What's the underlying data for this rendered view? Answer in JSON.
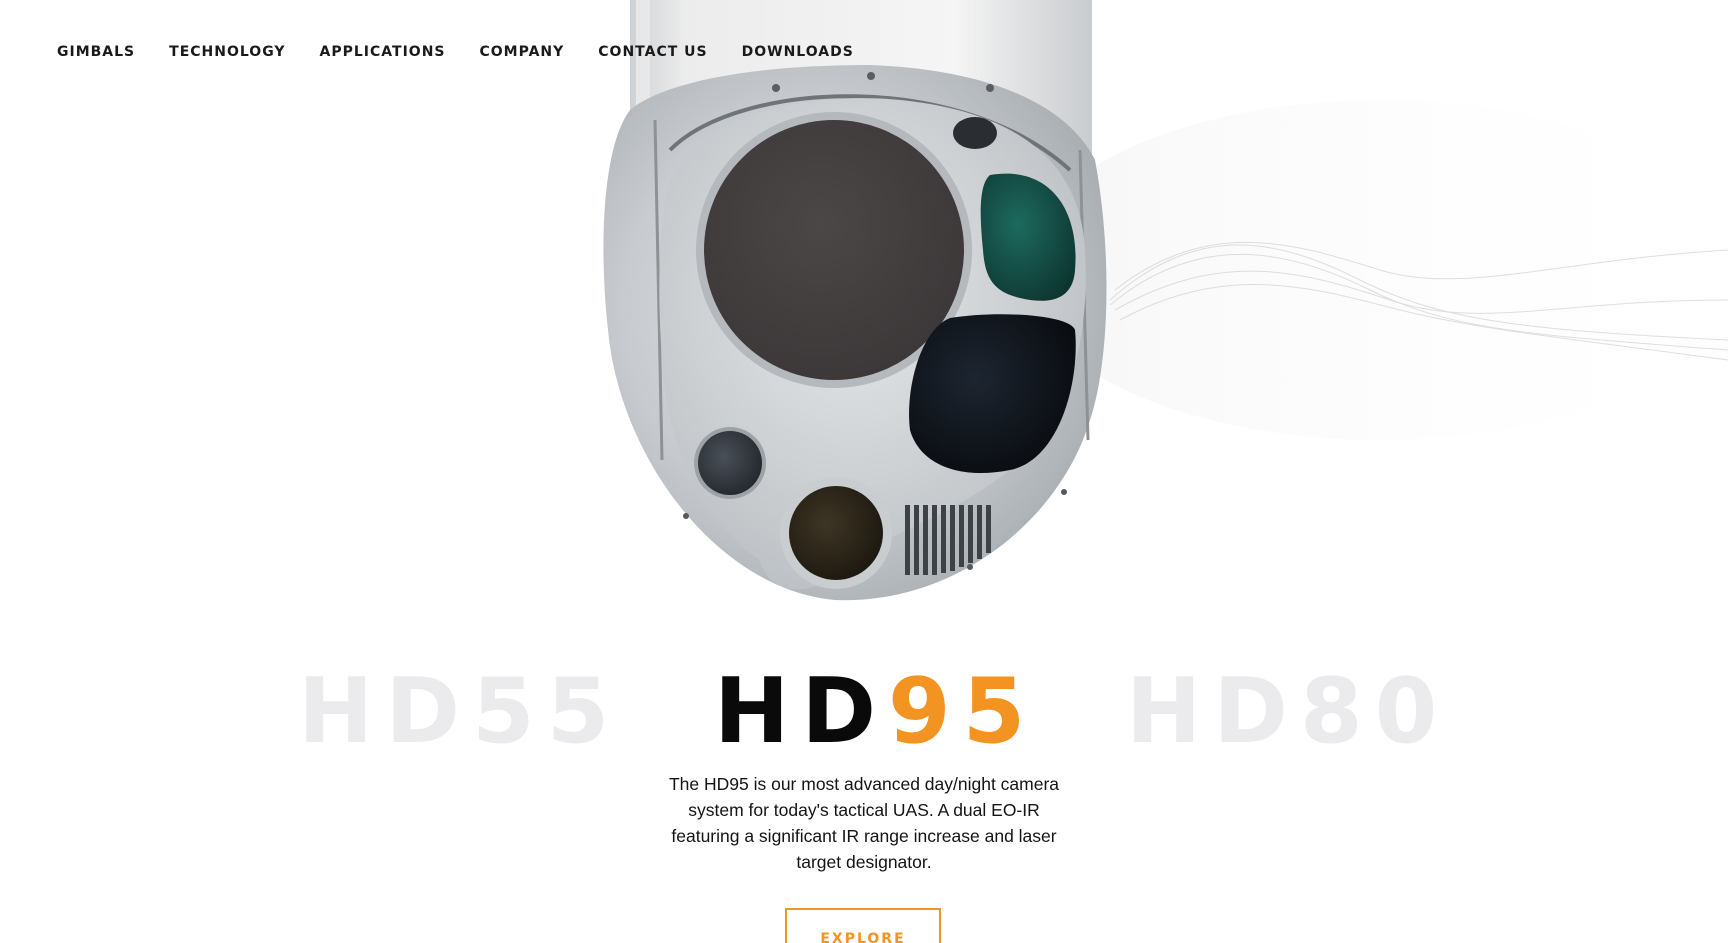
{
  "nav": {
    "items": [
      {
        "label": "GIMBALS"
      },
      {
        "label": "TECHNOLOGY"
      },
      {
        "label": "APPLICATIONS"
      },
      {
        "label": "COMPANY"
      },
      {
        "label": "CONTACT US"
      },
      {
        "label": "DOWNLOADS"
      }
    ]
  },
  "carousel": {
    "prev_model": "HD55",
    "current_model_prefix": "HD",
    "current_model_suffix": "95",
    "next_model": "HD80"
  },
  "description": "The HD95 is our most advanced day/night camera system for today's tactical UAS. A dual EO-IR featuring a significant IR range increase and laser target designator.",
  "cta": {
    "label": "EXPLORE"
  },
  "colors": {
    "accent": "#f39321",
    "text": "#0a0a0a",
    "inactive_model": "#ebebed",
    "background": "#ffffff"
  }
}
